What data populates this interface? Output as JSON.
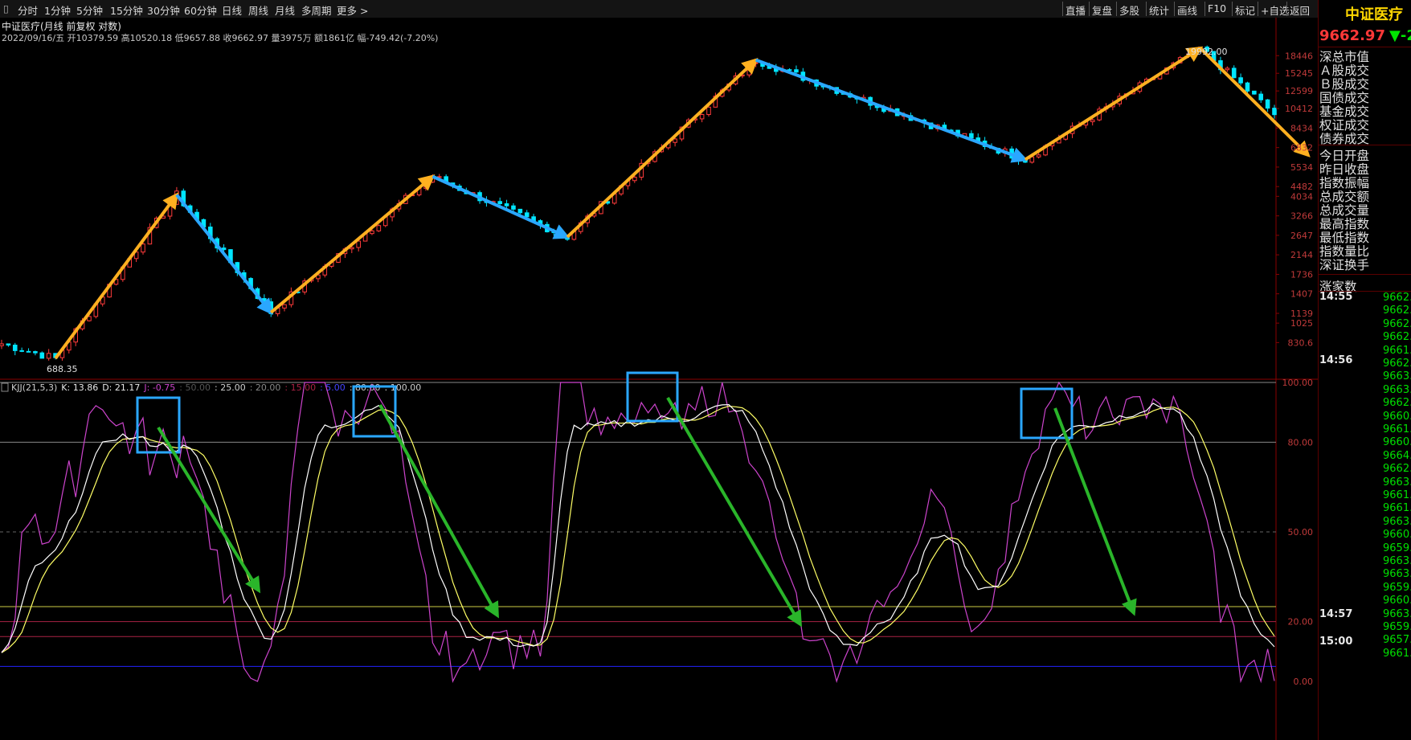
{
  "toolbar": {
    "left_items": [
      "分时",
      "1分钟",
      "5分钟",
      "15分钟",
      "30分钟",
      "60分钟",
      "日线",
      "周线",
      "月线",
      "多周期",
      "更多 >"
    ],
    "right_items": [
      "直播",
      "复盘",
      "多股",
      "统计",
      "画线",
      "F10",
      "标记",
      "+自选",
      "返回"
    ]
  },
  "chart_info": {
    "title": "中证医疗(月线 前复权 对数)",
    "ohlc_text": "2022/09/16/五 开10379.59 高10520.18 低9657.88 收9662.97 量3975万 额1861亿 幅-749.42(-7.20%)",
    "high_label": "19992.00",
    "low_label": "688.35"
  },
  "price_axis": {
    "ticks": [
      "18446",
      "15245",
      "12599",
      "10412",
      "8434",
      "6832",
      "5534",
      "4482",
      "4034",
      "3266",
      "2647",
      "2144",
      "1736",
      "1407",
      "1139",
      "1025",
      "830.6"
    ]
  },
  "indicator": {
    "legend": [
      "KJJ(21,5,3)",
      "K: 13.86",
      "D: 21.17",
      "J: -0.75",
      ": 50.00",
      ": 25.00",
      ": 20.00",
      ": 15.00",
      ": 5.00",
      ": 80.00",
      ": 100.00"
    ],
    "axis_ticks": [
      "100.00",
      "80.00",
      "50.00",
      "20.00",
      "0.00"
    ]
  },
  "sidebar": {
    "name": "中证医疗",
    "price": "9662.97",
    "change": "▼-2",
    "fields": [
      "深总市值",
      "Ａ股成交",
      "Ｂ股成交",
      "国债成交",
      "基金成交",
      "权证成交",
      "债券成交",
      "今日开盘",
      "昨日收盘",
      "指数振幅",
      "总成交额",
      "总成交量",
      "最高指数",
      "最低指数",
      "指数量比",
      "深证换手",
      "涨家数"
    ],
    "tick_times": [
      "14:55",
      "14:56",
      "14:57",
      "15:00"
    ],
    "tick_values": [
      "9662.",
      "9662.",
      "9662.",
      "9662.",
      "9661.",
      "9662.",
      "9663.",
      "9663.",
      "9662.",
      "9660.",
      "9661.",
      "9660.",
      "9664.",
      "9662.",
      "9663.",
      "9661.",
      "9661.",
      "9663.",
      "9660.",
      "9659.",
      "9663.",
      "9663.",
      "9659.",
      "9660.",
      "9663.",
      "9659.",
      "9657.",
      "9661."
    ]
  },
  "colors": {
    "up": "#ff3b3b",
    "down": "#00e5ff",
    "k_line": "#ffffff",
    "d_line": "#ffff66",
    "j_line": "#cc44cc",
    "trend_up": "#ffb020",
    "trend_down": "#2aa7ff",
    "highlight_box": "#2aa7ff",
    "signal_arrow": "#2ab52a"
  }
}
